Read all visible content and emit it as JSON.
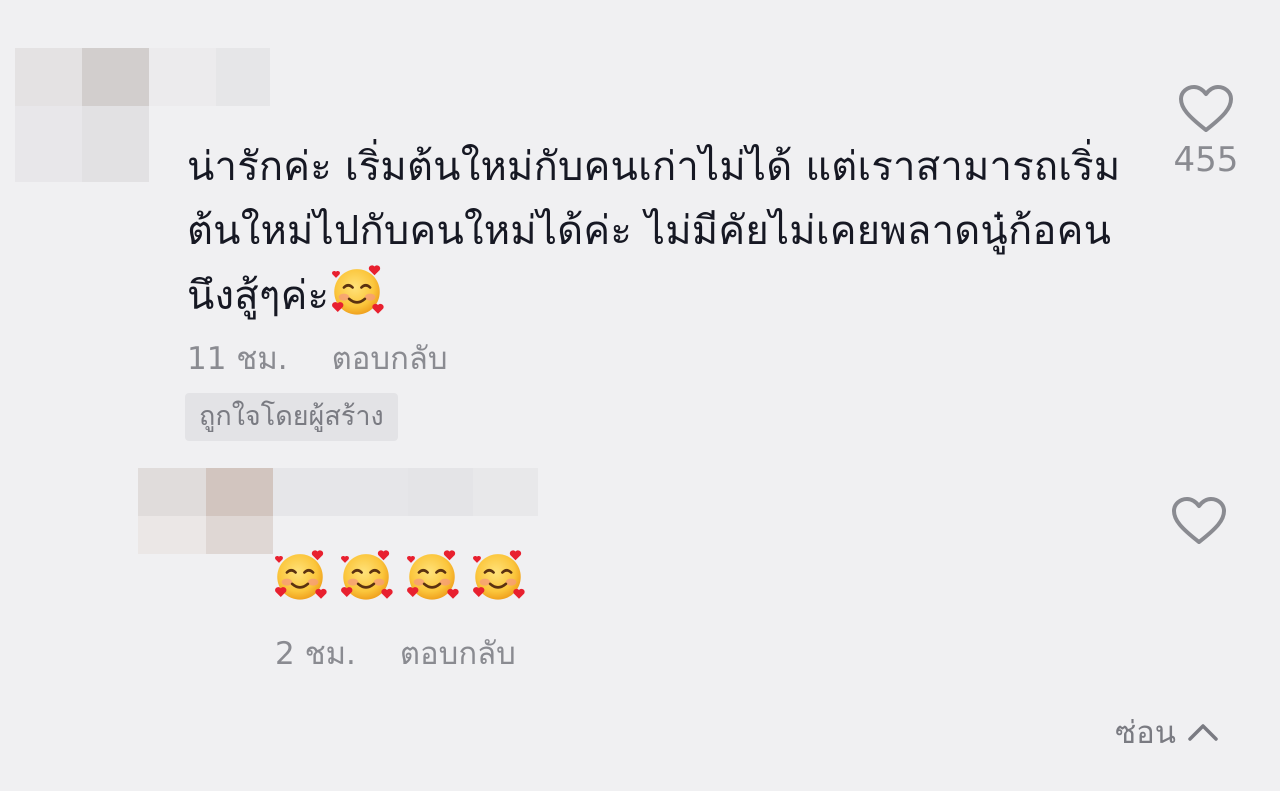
{
  "comments": [
    {
      "text": "น่ารักค่ะ เริ่มต้นใหม่กับคนเก่าไม่ได้ แต่เราสามารถเริ่มต้นใหม่ไปกับคนใหม่ได้ค่ะ ไม่มีคัยไม่เคยพลาดนู๋ก้อคนนึงสู้ๆค่ะ",
      "emoji": "smiling-face-with-hearts",
      "time": "11 ชม.",
      "reply": "ตอบกลับ",
      "badge": "ถูกใจโดยผู้สร้าง",
      "likes": "455"
    },
    {
      "emojis": [
        "smiling-face-with-hearts",
        "smiling-face-with-hearts",
        "smiling-face-with-hearts",
        "smiling-face-with-hearts"
      ],
      "time": "2 ชม.",
      "reply": "ตอบกลับ"
    }
  ],
  "hide_label": "ซ่อน",
  "colors": {
    "background": "#f0f0f2",
    "text": "#161823",
    "secondary": "#8a8b91",
    "badge_bg": "#e3e3e6"
  }
}
